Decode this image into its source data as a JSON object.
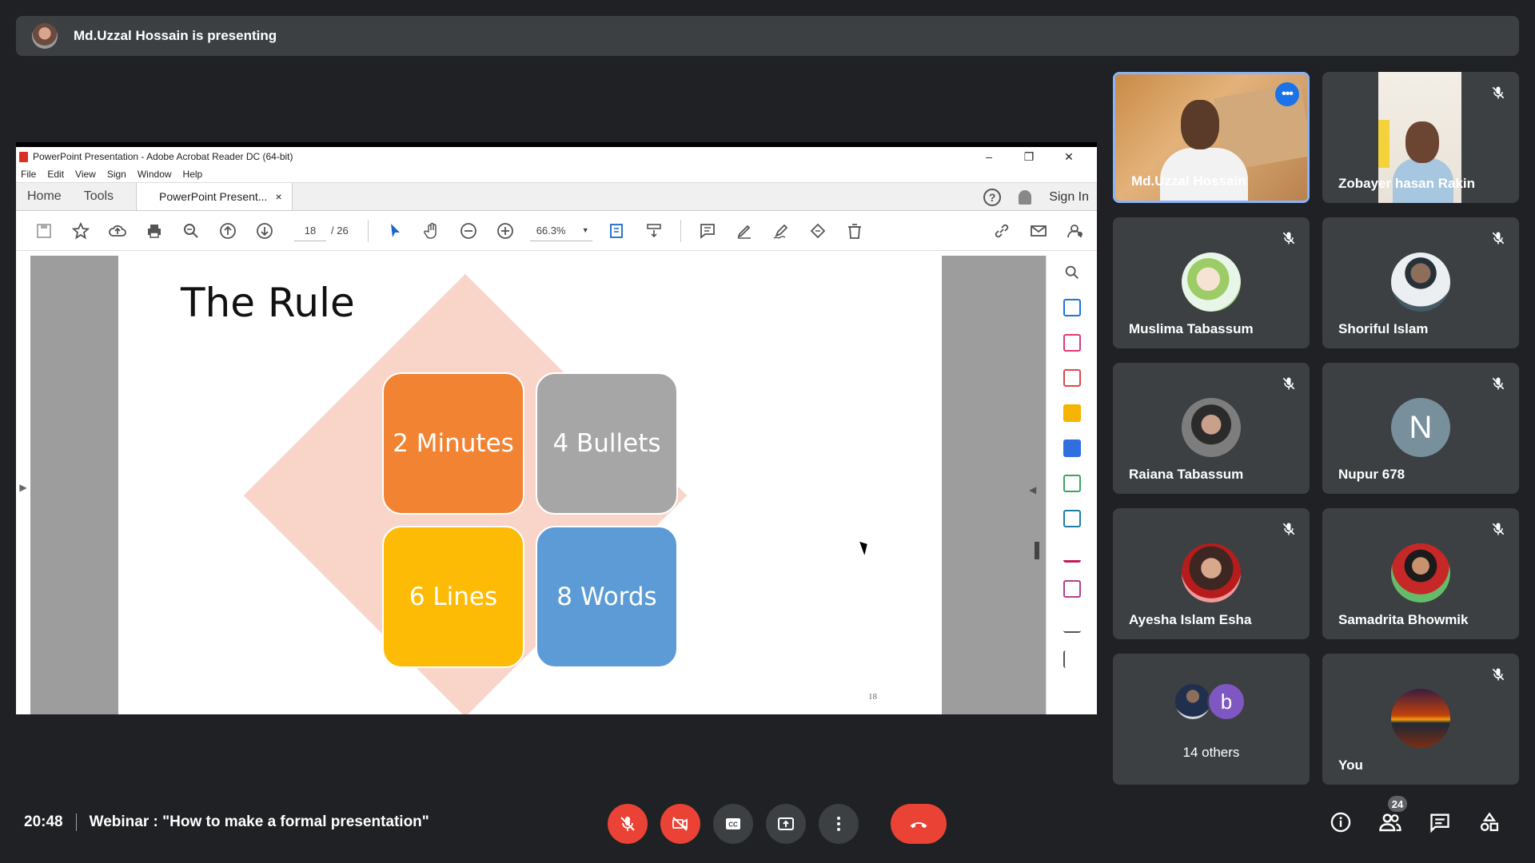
{
  "banner": {
    "text": "Md.Uzzal Hossain is presenting"
  },
  "acrobat": {
    "window_title": "PowerPoint Presentation - Adobe Acrobat Reader DC (64-bit)",
    "menu": [
      "File",
      "Edit",
      "View",
      "Sign",
      "Window",
      "Help"
    ],
    "tabs": {
      "home": "Home",
      "tools": "Tools",
      "doc": "PowerPoint Present...",
      "close": "×"
    },
    "sign_in": "Sign In",
    "help": "?",
    "page_current": "18",
    "page_total": "/ 26",
    "zoom": "66.3%"
  },
  "slide": {
    "title": "The Rule",
    "tiles": [
      "2 Minutes",
      "4 Bullets",
      "6 Lines",
      "8 Words"
    ],
    "page_number": "18"
  },
  "participants": [
    {
      "name": "Md.Uzzal Hossain",
      "type": "video",
      "speaking": true
    },
    {
      "name": "Zobayer hasan Rakin",
      "type": "video",
      "muted": true
    },
    {
      "name": "Muslima Tabassum",
      "type": "photo",
      "muted": true
    },
    {
      "name": "Shoriful Islam",
      "type": "photo",
      "muted": true
    },
    {
      "name": "Raiana Tabassum",
      "type": "photo",
      "muted": true
    },
    {
      "name": "Nupur 678",
      "type": "letter",
      "letter": "N",
      "muted": true
    },
    {
      "name": "Ayesha Islam Esha",
      "type": "photo",
      "muted": true
    },
    {
      "name": "Samadrita Bhowmik",
      "type": "photo",
      "muted": true
    },
    {
      "name": "14 others",
      "type": "group",
      "letter": "b"
    },
    {
      "name": "You",
      "type": "photo",
      "muted": true
    }
  ],
  "meeting": {
    "time": "20:48",
    "title": "Webinar : \"How to make a formal presentation\"",
    "participant_count": "24"
  },
  "colors": {
    "accent": "#8ab4f8",
    "end_call": "#ea4335",
    "tile_bg": "#3c4043",
    "bg": "#202124"
  }
}
